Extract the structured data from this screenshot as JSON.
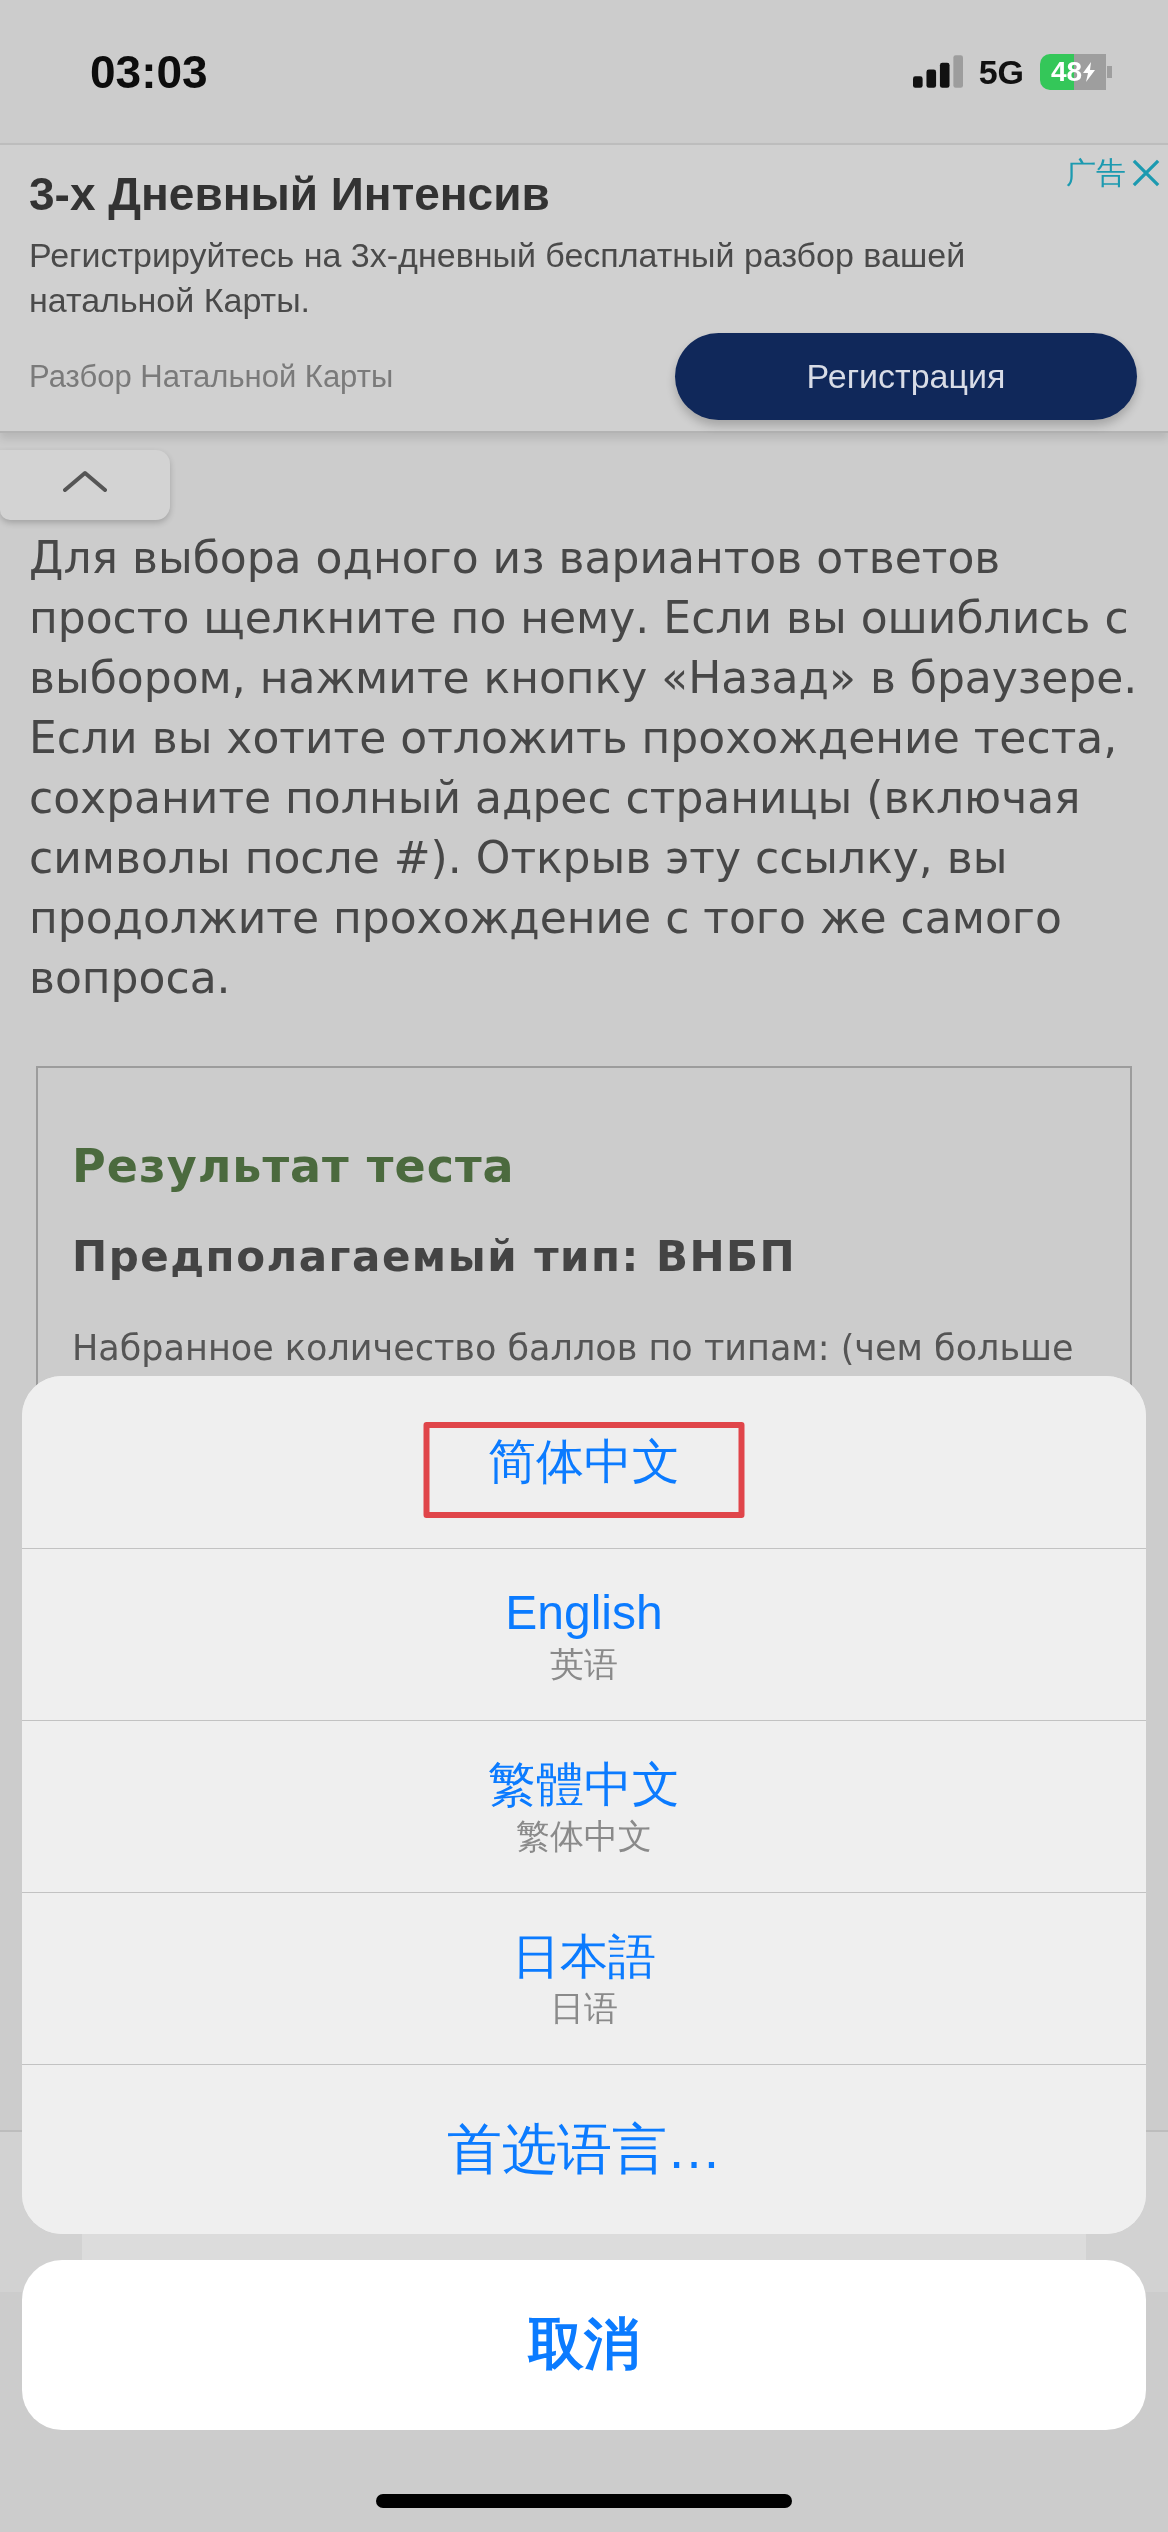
{
  "status_bar": {
    "time": "03:03",
    "network": "5G",
    "battery": "48"
  },
  "ad": {
    "label": "广告",
    "title": "3-х Дневный Интенсив",
    "description": "Регистрируйтесь на 3х-дневный бесплатный разбор вашей натальной Карты.",
    "advertiser": "Разбор Натальной Карты",
    "button": "Регистрация"
  },
  "article": {
    "paragraph": "Для выбора одного из вариантов ответов просто щелкните по нему. Если вы ошиблись с выбором, нажмите кнопку «Назад» в браузере. Если вы хотите отложить прохождение теста, сохраните полный адрес страницы (включая символы после #). Открыв эту ссылку, вы продолжите прохождение с того же самого вопроса."
  },
  "result": {
    "title": "Результат теста",
    "type_line": "Предполагаемый тип: ВНБП",
    "scores_line": "Набранное количество баллов по типам: (чем больше"
  },
  "language_sheet": {
    "options": [
      {
        "label": "简体中文",
        "highlighted": true
      },
      {
        "label": "English",
        "subtitle": "英语",
        "highlighted": false
      },
      {
        "label": "繁體中文",
        "subtitle": "繁体中文",
        "highlighted": false
      },
      {
        "label": "日本語",
        "subtitle": "日语",
        "highlighted": false
      }
    ],
    "more": "首选语言…",
    "cancel": "取消"
  }
}
